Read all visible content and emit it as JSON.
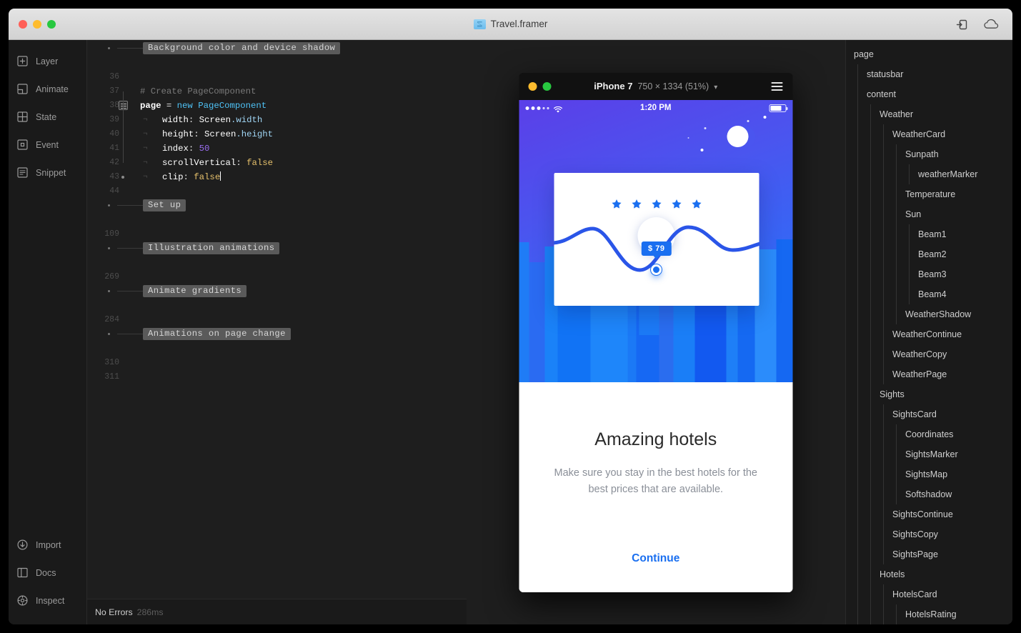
{
  "window": {
    "title": "Travel.framer",
    "doc_icon": "framer-document-icon",
    "traffic": [
      "close-button",
      "minimize-button",
      "zoom-button"
    ],
    "right_icons": [
      {
        "name": "export-icon",
        "label": "Export"
      },
      {
        "name": "cloud-icon",
        "label": "Cloud"
      }
    ]
  },
  "sidebar": {
    "top_items": [
      {
        "label": "Layer",
        "icon": "layer-icon"
      },
      {
        "label": "Animate",
        "icon": "animate-icon"
      },
      {
        "label": "State",
        "icon": "state-icon"
      },
      {
        "label": "Event",
        "icon": "event-icon"
      },
      {
        "label": "Snippet",
        "icon": "snippet-icon"
      }
    ],
    "bottom_items": [
      {
        "label": "Import",
        "icon": "import-icon"
      },
      {
        "label": "Docs",
        "icon": "docs-icon"
      },
      {
        "label": "Inspect",
        "icon": "inspect-icon"
      }
    ]
  },
  "editor": {
    "rows": [
      {
        "kind": "fold",
        "chip": "Background color and device shadow",
        "line": ""
      },
      {
        "kind": "blank",
        "line": "36"
      },
      {
        "kind": "code",
        "line": "37",
        "html": "<span class=\"tok-com\"># Create PageComponent</span>"
      },
      {
        "kind": "code",
        "line": "38",
        "foldbox": true,
        "html": "<span class=\"tok-id\">page</span> = <span class=\"tok-kw\">new</span> <span class=\"tok-cls\">PageComponent</span>"
      },
      {
        "kind": "code",
        "line": "39",
        "indent": true,
        "cont": true,
        "html": "<span class=\"tok-prop\">width</span>: <span class=\"tok-prop\">Screen</span><span class=\"tok-mem\">.width</span>"
      },
      {
        "kind": "code",
        "line": "40",
        "indent": true,
        "cont": true,
        "html": "<span class=\"tok-prop\">height</span>: <span class=\"tok-prop\">Screen</span><span class=\"tok-mem\">.height</span>"
      },
      {
        "kind": "code",
        "line": "41",
        "indent": true,
        "cont": true,
        "html": "<span class=\"tok-prop\">index</span>: <span class=\"tok-num\">50</span>"
      },
      {
        "kind": "code",
        "line": "42",
        "indent": true,
        "cont": true,
        "html": "<span class=\"tok-prop\">scrollVertical</span>: <span class=\"tok-bool\">false</span>"
      },
      {
        "kind": "code",
        "line": "43",
        "indent": true,
        "cont": true,
        "foldend": true,
        "html": "<span class=\"tok-prop\">clip</span>: <span class=\"tok-bool\">false</span><span class=\"caret\"></span>"
      },
      {
        "kind": "blank",
        "line": "44"
      },
      {
        "kind": "fold",
        "chip": "Set up",
        "line": ""
      },
      {
        "kind": "blank",
        "line": "109"
      },
      {
        "kind": "fold",
        "chip": "Illustration animations",
        "line": ""
      },
      {
        "kind": "blank",
        "line": "269"
      },
      {
        "kind": "fold",
        "chip": "Animate gradients",
        "line": ""
      },
      {
        "kind": "blank",
        "line": "284"
      },
      {
        "kind": "fold",
        "chip": "Animations on page change",
        "line": ""
      },
      {
        "kind": "blank",
        "line": "310"
      },
      {
        "kind": "blank",
        "line": "311"
      }
    ]
  },
  "status": {
    "errors": "No Errors",
    "time": "286ms"
  },
  "preview": {
    "device": "iPhone 7",
    "dimensions": "750 × 1334 (51%)",
    "chevron": "▾",
    "menu_icon": "hamburger-menu-icon",
    "traffic": [
      "minimize-button",
      "zoom-button"
    ],
    "ios_status": {
      "time": "1:20 PM",
      "signal": "signal-dots",
      "wifi": "wifi-icon",
      "battery": "battery-icon"
    },
    "card": {
      "rating_stars": 5,
      "price_label": "$ 79",
      "marker": "weather-marker"
    },
    "sheet": {
      "title": "Amazing hotels",
      "subtitle": "Make sure you stay in the best hotels for the best prices that are available.",
      "cta": "Continue"
    },
    "colors": {
      "accent": "#1a6ff0",
      "sky_top": "#5b3fe8",
      "sky_bottom": "#1b7bfa"
    }
  },
  "layers": [
    {
      "label": "page",
      "depth": 0
    },
    {
      "label": "statusbar",
      "depth": 1
    },
    {
      "label": "content",
      "depth": 1
    },
    {
      "label": "Weather",
      "depth": 2
    },
    {
      "label": "WeatherCard",
      "depth": 3
    },
    {
      "label": "Sunpath",
      "depth": 4
    },
    {
      "label": "weatherMarker",
      "depth": 5
    },
    {
      "label": "Temperature",
      "depth": 4
    },
    {
      "label": "Sun",
      "depth": 4
    },
    {
      "label": "Beam1",
      "depth": 5
    },
    {
      "label": "Beam2",
      "depth": 5
    },
    {
      "label": "Beam3",
      "depth": 5
    },
    {
      "label": "Beam4",
      "depth": 5
    },
    {
      "label": "WeatherShadow",
      "depth": 4
    },
    {
      "label": "WeatherContinue",
      "depth": 3
    },
    {
      "label": "WeatherCopy",
      "depth": 3
    },
    {
      "label": "WeatherPage",
      "depth": 3
    },
    {
      "label": "Sights",
      "depth": 2
    },
    {
      "label": "SightsCard",
      "depth": 3
    },
    {
      "label": "Coordinates",
      "depth": 4
    },
    {
      "label": "SightsMarker",
      "depth": 4
    },
    {
      "label": "SightsMap",
      "depth": 4
    },
    {
      "label": "Softshadow",
      "depth": 4
    },
    {
      "label": "SightsContinue",
      "depth": 3
    },
    {
      "label": "SightsCopy",
      "depth": 3
    },
    {
      "label": "SightsPage",
      "depth": 3
    },
    {
      "label": "Hotels",
      "depth": 2
    },
    {
      "label": "HotelsCard",
      "depth": 3
    },
    {
      "label": "HotelsRating",
      "depth": 4
    }
  ]
}
